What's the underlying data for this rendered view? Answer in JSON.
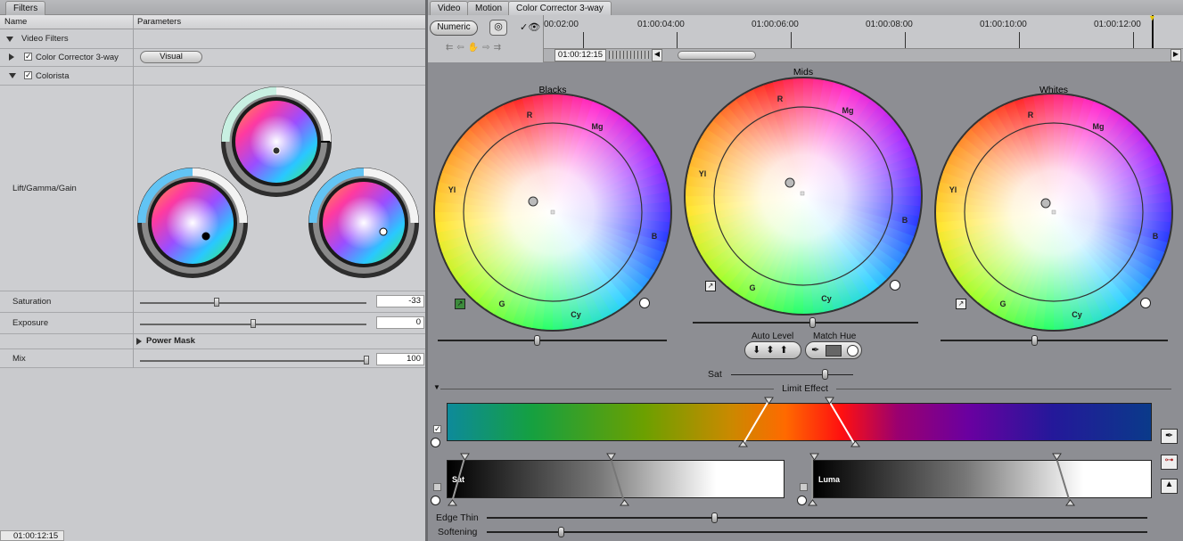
{
  "left": {
    "tab": "Filters",
    "headers": {
      "name": "Name",
      "parameters": "Parameters"
    },
    "video_filters": "Video Filters",
    "cc3way": {
      "label": "Color Corrector 3-way",
      "button": "Visual"
    },
    "colorista": "Colorista",
    "lgg": "Lift/Gamma/Gain",
    "params": [
      {
        "label": "Saturation",
        "value": "-33",
        "level": 0.34
      },
      {
        "label": "Exposure",
        "value": "0",
        "level": 0.5
      },
      {
        "label": "Mix",
        "value": "100",
        "level": 1.0
      }
    ],
    "power_mask": "Power Mask",
    "timecode": "01:00:12:15"
  },
  "tabs": [
    "Video",
    "Motion",
    "Color Corrector 3-way"
  ],
  "toolbar": {
    "numeric": "Numeric",
    "timecode": "01:00:12:15"
  },
  "ruler": [
    "00:02:00",
    "01:00:04:00",
    "01:00:06:00",
    "01:00:08:00",
    "01:00:10:00",
    "01:00:12:00"
  ],
  "wheels": {
    "blacks": {
      "label": "Blacks",
      "R": "R",
      "Mg": "Mg",
      "B": "B",
      "Cy": "Cy",
      "G": "G",
      "Yl": "Yl",
      "level": 0.43
    },
    "mids": {
      "label": "Mids",
      "R": "R",
      "Mg": "Mg",
      "B": "B",
      "Cy": "Cy",
      "G": "G",
      "Yl": "Yl",
      "level": 0.53
    },
    "whites": {
      "label": "Whites",
      "R": "R",
      "Mg": "Mg",
      "B": "B",
      "Cy": "Cy",
      "G": "G",
      "Yl": "Yl",
      "level": 0.41
    }
  },
  "controls": {
    "auto_level": "Auto Level",
    "match_hue": "Match Hue",
    "sat": "Sat",
    "limit_effect": "Limit Effect",
    "sat_bar": "Sat",
    "luma_bar": "Luma",
    "edge_thin": "Edge Thin",
    "softening": "Softening"
  },
  "colors": {
    "panel": "#8d8e93",
    "left_bg": "#c9cacd"
  }
}
